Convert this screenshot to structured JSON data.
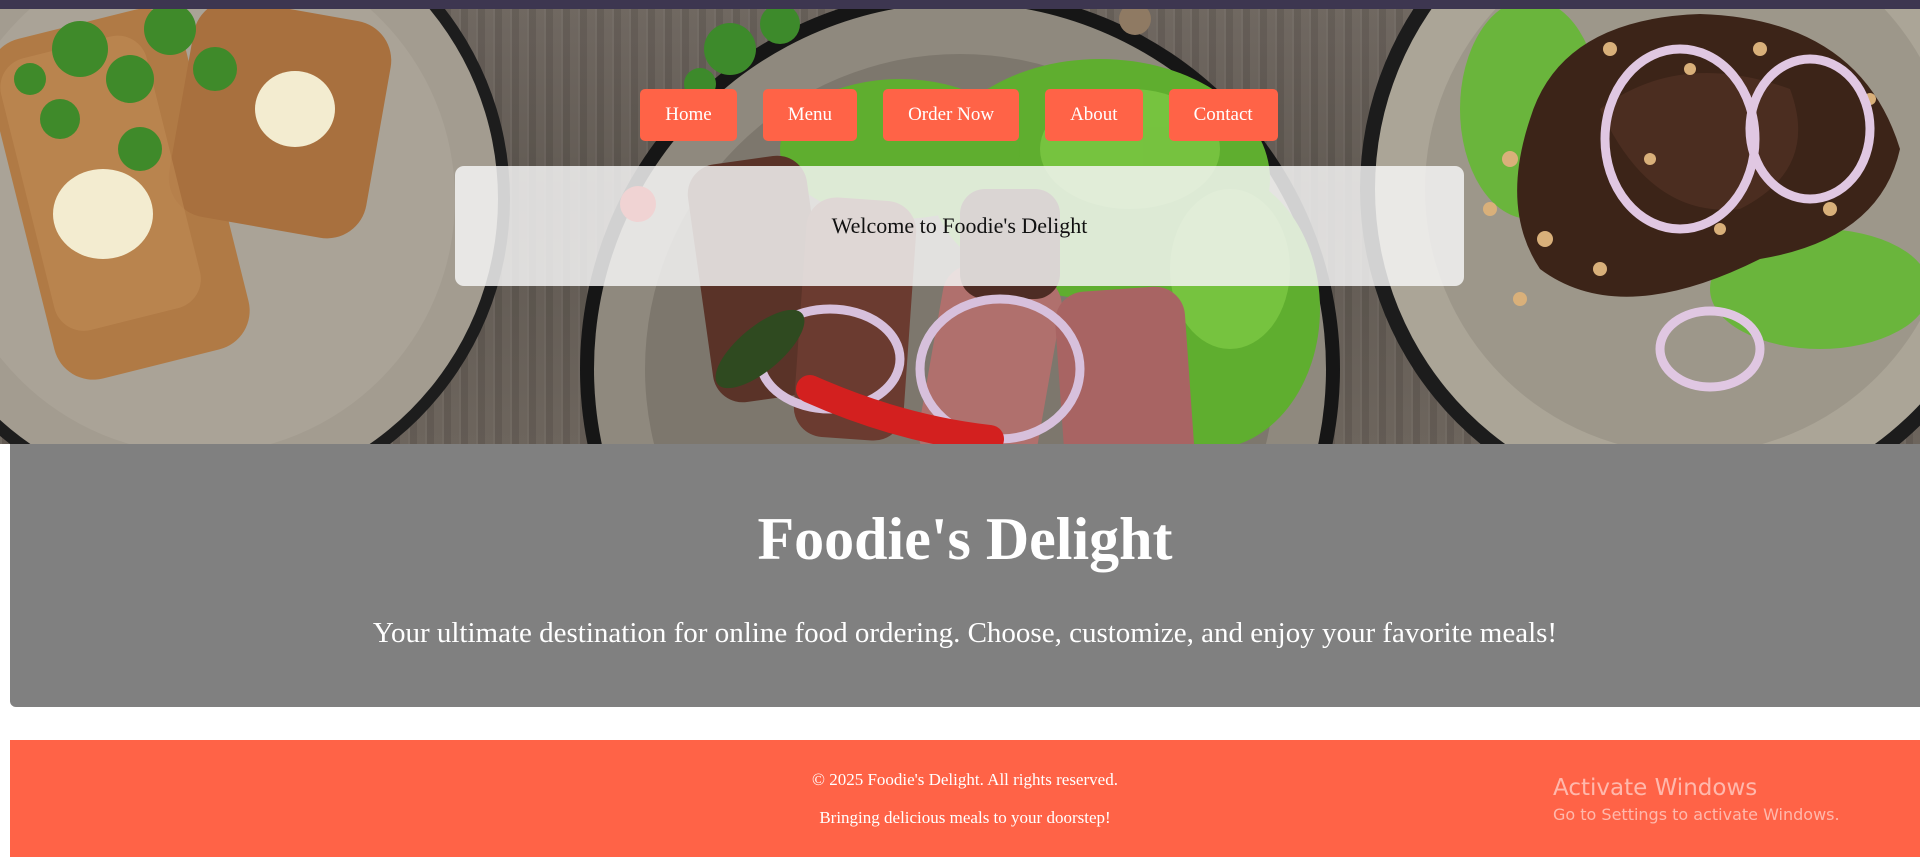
{
  "nav": {
    "items": [
      {
        "label": "Home"
      },
      {
        "label": "Menu"
      },
      {
        "label": "Order Now"
      },
      {
        "label": "About"
      },
      {
        "label": "Contact"
      }
    ]
  },
  "hero": {
    "welcome_text": "Welcome to Foodie's Delight"
  },
  "intro": {
    "title": "Foodie's Delight",
    "tagline": "Your ultimate destination for online food ordering. Choose, customize, and enjoy your favorite meals!"
  },
  "footer": {
    "copyright": "© 2025 Foodie's Delight. All rights reserved.",
    "slogan": "Bringing delicious meals to your doorstep!"
  },
  "watermark": {
    "title": "Activate Windows",
    "subtitle": "Go to Settings to activate Windows."
  },
  "colors": {
    "accent": "#ff6347",
    "intro_bg": "#808080",
    "top_bar": "#3d3650"
  }
}
